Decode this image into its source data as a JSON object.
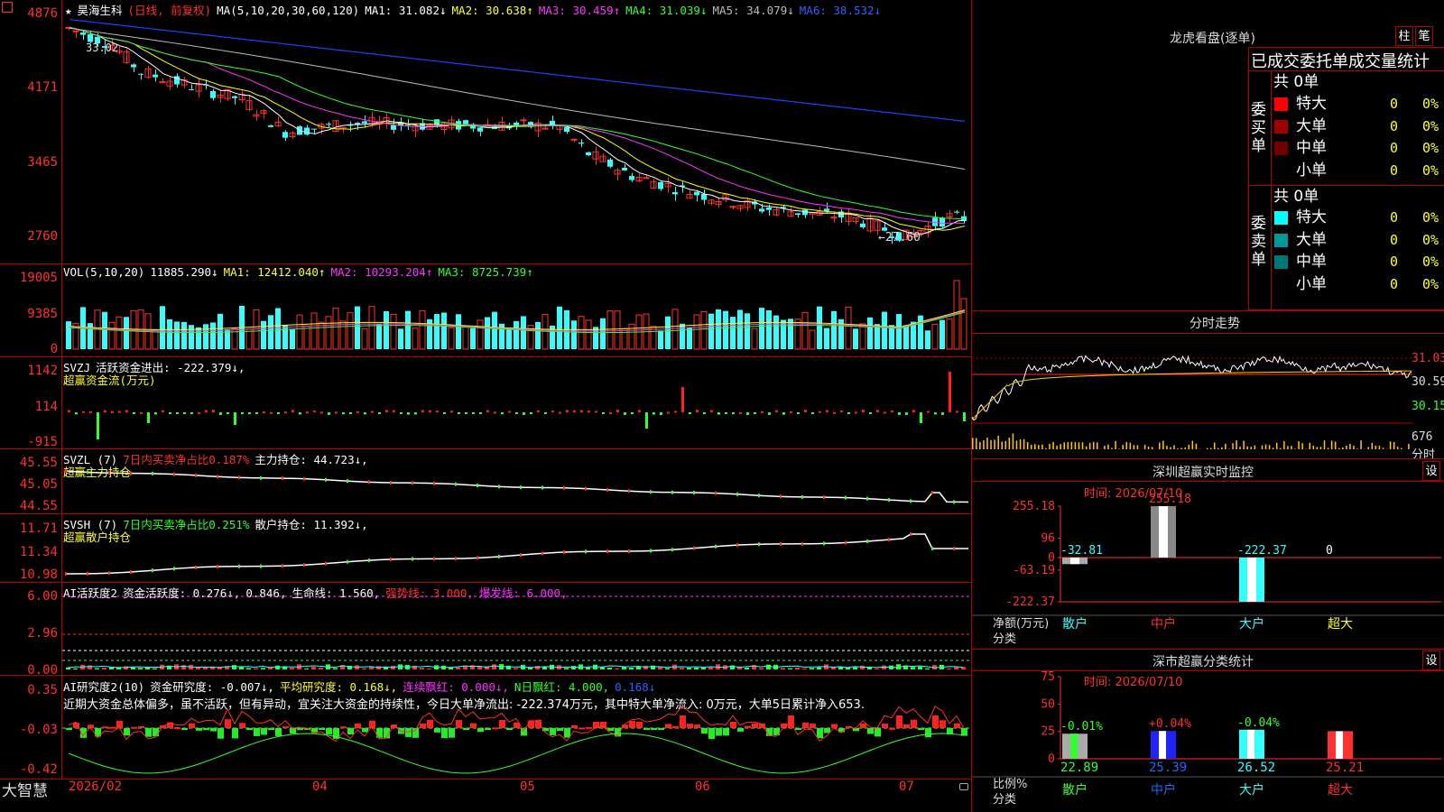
{
  "corner_icon": "chevron-icon",
  "main": {
    "title_star": "★",
    "title_stock": "昊海生科",
    "title_mode": "(日线, 前复权)",
    "ma_header": "MA(5,10,20,30,60,120)",
    "ma1": "MA1: 31.082↓",
    "ma2": "MA2: 30.638↑",
    "ma3": "MA3: 30.459↑",
    "ma4": "MA4: 31.039↓",
    "ma5": "MA5: 34.079↓",
    "ma6": "MA6: 38.532↓",
    "price_labels": [
      "4876",
      "4171",
      "3465",
      "2760"
    ],
    "low_label": "←27.60",
    "high_label": "33.02",
    "colors": {
      "ma1": "#ffffff",
      "ma2": "#ffff00",
      "ma3": "#ff33ff",
      "ma4": "#33ff33",
      "ma5": "#bbbbbb",
      "ma6": "#2040ff"
    }
  },
  "vol": {
    "header": "VOL(5,10,20)",
    "value": "11885.290↓",
    "ma1": "MA1: 12412.040↑",
    "ma2": "MA2: 10293.204↑",
    "ma3": "MA3: 8725.739↑",
    "labels": [
      "19005",
      "9385",
      "0"
    ]
  },
  "svzj": {
    "header": "SVZJ",
    "text1": "活跃资金进出: -222.379↓,",
    "text2": "超赢资金流(万元)",
    "labels": [
      "1142",
      "114",
      "-915"
    ]
  },
  "svzl": {
    "header": "SVZL (7)",
    "text1": "7日内买卖净占比0.187%",
    "text2": "主力持仓: 44.723↓,",
    "text3": "超赢主力持仓",
    "labels": [
      "45.55",
      "45.05",
      "44.55"
    ]
  },
  "svsh": {
    "header": "SVSH (7)",
    "text1": "7日内买卖净占比0.251%",
    "text2": "散户持仓: 11.392↓,",
    "text3": "超赢散户持仓",
    "labels": [
      "11.71",
      "11.34",
      "10.98"
    ]
  },
  "ai1": {
    "header": "AI活跃度2",
    "text1": "资金活跃度: 0.276↓,",
    "text2": "0.846,",
    "text3": "生命线: 1.560,",
    "text4": "强势线: 3.000,",
    "text5": "爆发线: 6.000,",
    "labels": [
      "6.00",
      "2.96",
      "0.00"
    ]
  },
  "ai2": {
    "header": "AI研究度2(10)",
    "text1": "资金研究度: -0.007↓,",
    "text2": "平均研究度: 0.168↓,",
    "text3": "连续飘红: 0.000↓,",
    "text4": "N日飘红: 4.000,",
    "text5": "0.168↓",
    "comment": "近期大资金总体偏多，虽不活跃，但有异动，宜关注大资金的持续性，今日大单净流出: -222.374万元，其中特大单净流入: 0万元，大单5日累计净入653.",
    "labels": [
      "0.35",
      "-0.03",
      "-0.42"
    ]
  },
  "xaxis": {
    "brand": "大智慧",
    "labels": [
      "2026/02",
      "04",
      "05",
      "06",
      "07"
    ]
  },
  "right": {
    "lhb_title": "龙虎看盘(逐单)",
    "btn_bar": "柱",
    "btn_stroke": "笔",
    "stat_title": "已成交委托单成交量统计",
    "buy_side": "委买单",
    "sell_side": "委卖单",
    "buy_total": "共 0单",
    "sell_total": "共 0单",
    "buy_rows": [
      {
        "name": "特大",
        "val": "0",
        "pct": "0%",
        "color": "#ff0000"
      },
      {
        "name": "大单",
        "val": "0",
        "pct": "0%",
        "color": "#a00000"
      },
      {
        "name": "中单",
        "val": "0",
        "pct": "0%",
        "color": "#700000"
      },
      {
        "name": "小单",
        "val": "0",
        "pct": "0%",
        "color": "#000000"
      }
    ],
    "sell_rows": [
      {
        "name": "特大",
        "val": "0",
        "pct": "0%",
        "color": "#00ffff"
      },
      {
        "name": "大单",
        "val": "0",
        "pct": "0%",
        "color": "#009999"
      },
      {
        "name": "中单",
        "val": "0",
        "pct": "0%",
        "color": "#007777"
      },
      {
        "name": "小单",
        "val": "0",
        "pct": "0%",
        "color": "#000000"
      }
    ],
    "fs_title": "分时走势",
    "fs_labels": [
      "31.03",
      "30.59",
      "30.15",
      "676"
    ],
    "fs_unit": "分时",
    "monitor_title": "深圳超赢实时监控",
    "monitor_btn": "设",
    "monitor_time": "时间: 2026/07/10",
    "monitor_axis": [
      "255.18",
      "96",
      "0",
      "-63.19",
      "-222.37"
    ],
    "monitor_values": [
      "-32.81",
      "255.18",
      "-222.37",
      "0"
    ],
    "monitor_unit": "净额(万元)",
    "monitor_cat": "分类",
    "cats": [
      "散户",
      "中户",
      "大户",
      "超大"
    ],
    "class_title": "深市超赢分类统计",
    "class_btn": "设",
    "class_time": "时间: 2026/07/10",
    "class_axis": [
      "75",
      "50",
      "25",
      "0"
    ],
    "class_changes": [
      "-0.01%",
      "+0.04%",
      "-0.04%"
    ],
    "class_values": [
      "22.89",
      "25.39",
      "26.52",
      "25.21"
    ],
    "class_unit": "比例%",
    "class_cat": "分类"
  }
}
